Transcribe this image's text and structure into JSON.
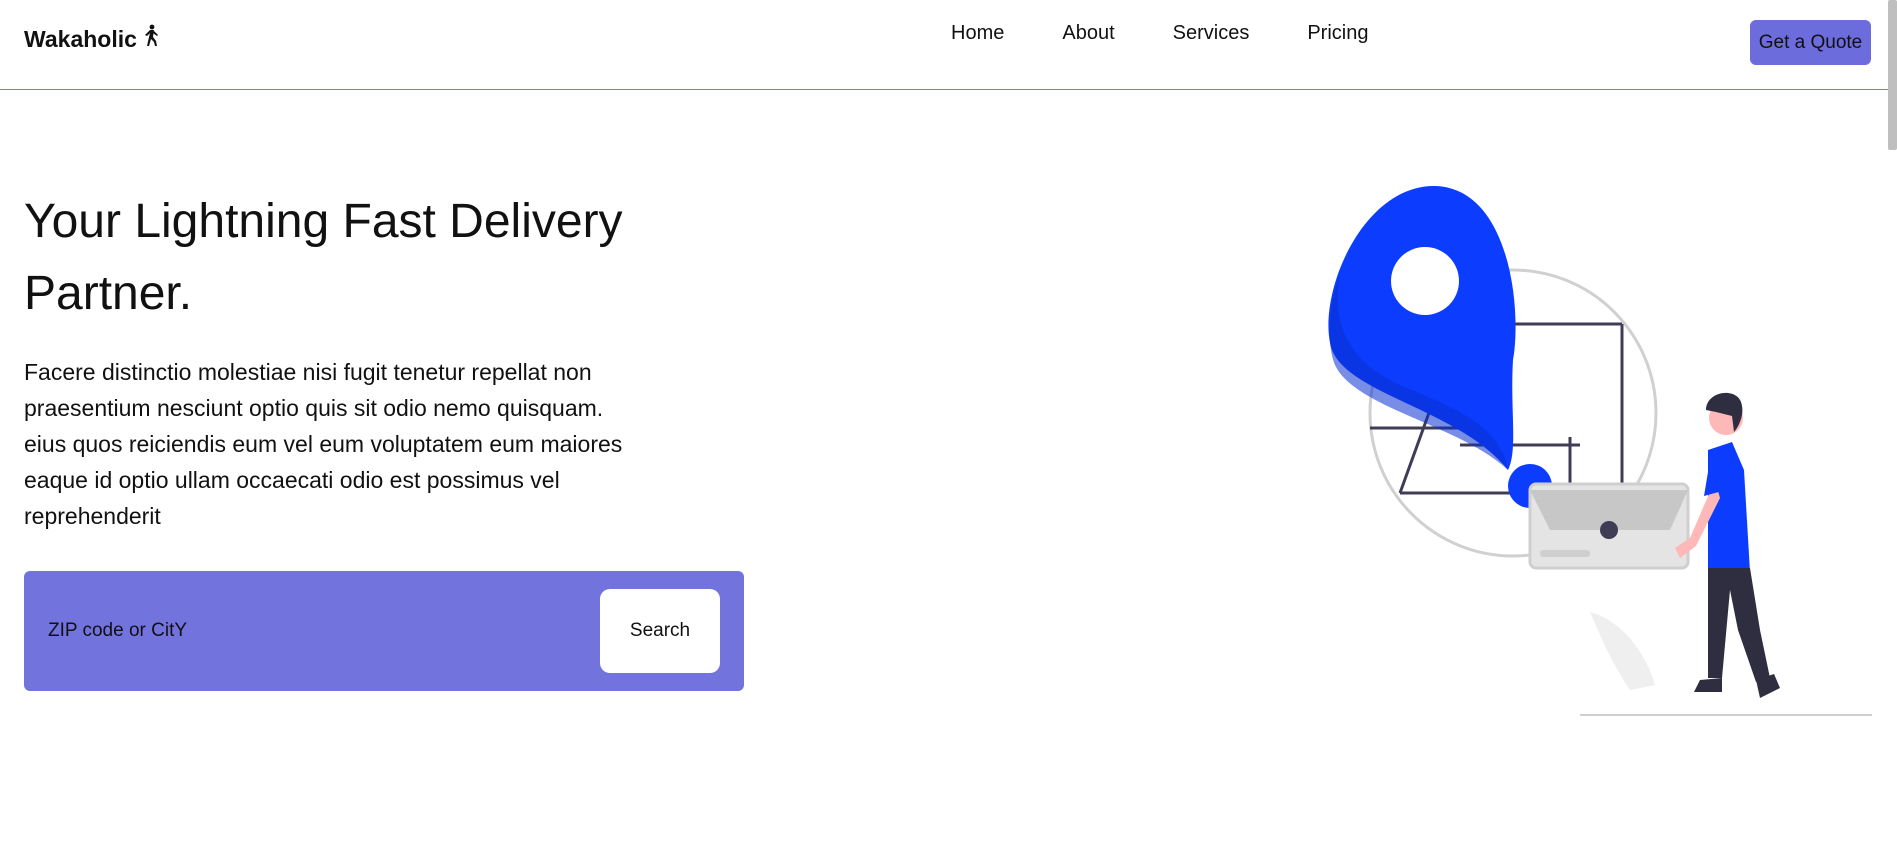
{
  "header": {
    "logo_text": "Wakaholic",
    "logo_icon": "walking-person-icon",
    "nav": [
      {
        "label": "Home"
      },
      {
        "label": "About"
      },
      {
        "label": "Services"
      },
      {
        "label": "Pricing"
      }
    ],
    "cta_label": "Get a Quote"
  },
  "hero": {
    "title": "Your Lightning Fast Delivery Partner.",
    "description": "Facere distinctio molestiae nisi fugit tenetur repellat non praesentium nesciunt optio quis sit odio nemo quisquam. eius quos reiciendis eum vel eum voluptatem eum maiores eaque id optio ullam occaecati odio est possimus vel reprehenderit",
    "search": {
      "placeholder": "ZIP code or CitY",
      "value": "",
      "button_label": "Search"
    },
    "illustration": "delivery-location-illustration"
  },
  "colors": {
    "accent": "#6c6cdc",
    "search_bg": "#7373de",
    "pin_blue": "#0c3dff",
    "header_border": "#7b7be0"
  }
}
